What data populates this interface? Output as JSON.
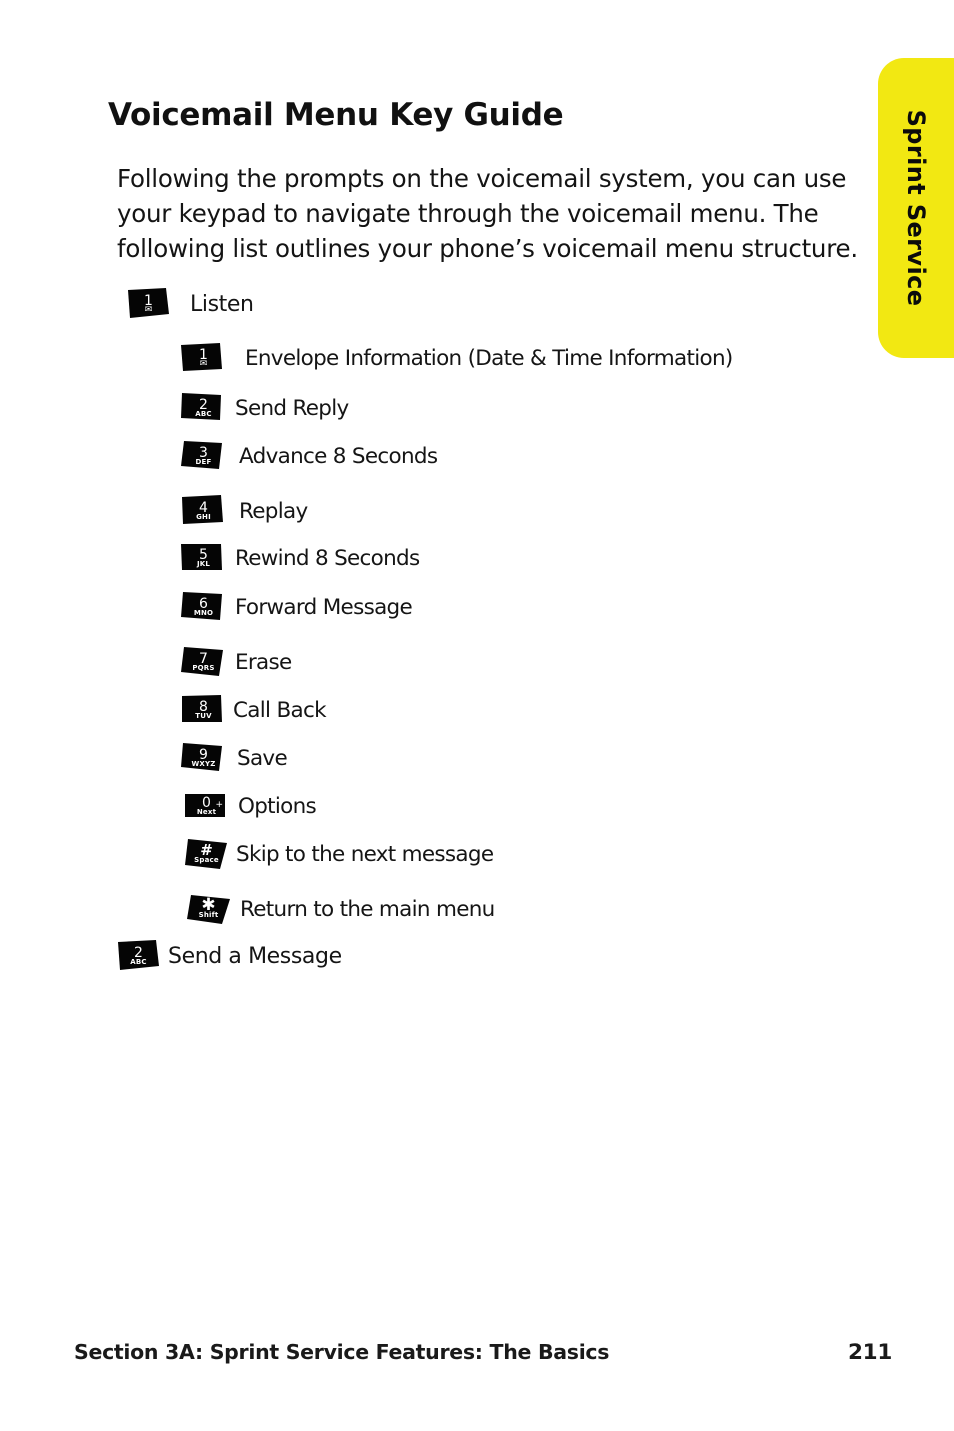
{
  "side_tab": {
    "label": "Sprint Service",
    "color": "#F2E812"
  },
  "page_title": "Voicemail Menu Key Guide",
  "intro_paragraph": "Following the prompts on the voicemail system, you can use your keypad to navigate through the voicemail menu. The following list outlines your phone’s voicemail menu structure.",
  "key_list": [
    {
      "level": 0,
      "key": {
        "num": "1",
        "sub": "",
        "glyph": "envelope",
        "icon_name": "keypad-key-1-envelope"
      },
      "label": "Listen"
    },
    {
      "level": 1,
      "key": {
        "num": "1",
        "sub": "",
        "glyph": "envelope",
        "icon_name": "keypad-key-1-envelope"
      },
      "label": "Envelope Information (Date & Time Information)"
    },
    {
      "level": 1,
      "key": {
        "num": "2",
        "sub": "ABC",
        "glyph": "",
        "icon_name": "keypad-key-2-abc"
      },
      "label": "Send Reply"
    },
    {
      "level": 1,
      "key": {
        "num": "3",
        "sub": "DEF",
        "glyph": "",
        "icon_name": "keypad-key-3-def"
      },
      "label": "Advance 8 Seconds"
    },
    {
      "level": 1,
      "key": {
        "num": "4",
        "sub": "GHI",
        "glyph": "",
        "icon_name": "keypad-key-4-ghi"
      },
      "label": "Replay"
    },
    {
      "level": 1,
      "key": {
        "num": "5",
        "sub": "JKL",
        "glyph": "",
        "icon_name": "keypad-key-5-jkl"
      },
      "label": "Rewind 8 Seconds"
    },
    {
      "level": 1,
      "key": {
        "num": "6",
        "sub": "MNO",
        "glyph": "",
        "icon_name": "keypad-key-6-mno"
      },
      "label": "Forward Message"
    },
    {
      "level": 1,
      "key": {
        "num": "7",
        "sub": "PQRS",
        "glyph": "",
        "icon_name": "keypad-key-7-pqrs"
      },
      "label": "Erase"
    },
    {
      "level": 1,
      "key": {
        "num": "8",
        "sub": "TUV",
        "glyph": "",
        "icon_name": "keypad-key-8-tuv"
      },
      "label": "Call Back"
    },
    {
      "level": 1,
      "key": {
        "num": "9",
        "sub": "WXYZ",
        "glyph": "",
        "icon_name": "keypad-key-9-wxyz"
      },
      "label": "Save"
    },
    {
      "level": 1,
      "key": {
        "num": "0",
        "sub": "Next",
        "glyph": "plus",
        "icon_name": "keypad-key-0-next"
      },
      "label": "Options"
    },
    {
      "level": 1,
      "key": {
        "num": "#",
        "sub": "Space",
        "glyph": "",
        "icon_name": "keypad-key-hash-space"
      },
      "label": "Skip to the next message"
    },
    {
      "level": 1,
      "key": {
        "num": "✱",
        "sub": "Shift",
        "glyph": "",
        "icon_name": "keypad-key-star-shift"
      },
      "label": "Return to the main menu"
    },
    {
      "level": 0,
      "key": {
        "num": "2",
        "sub": "ABC",
        "glyph": "",
        "icon_name": "keypad-key-2-abc"
      },
      "label": "Send a Message"
    }
  ],
  "footer": {
    "section": "Section 3A: Sprint Service Features: The Basics",
    "page_number": "211"
  }
}
